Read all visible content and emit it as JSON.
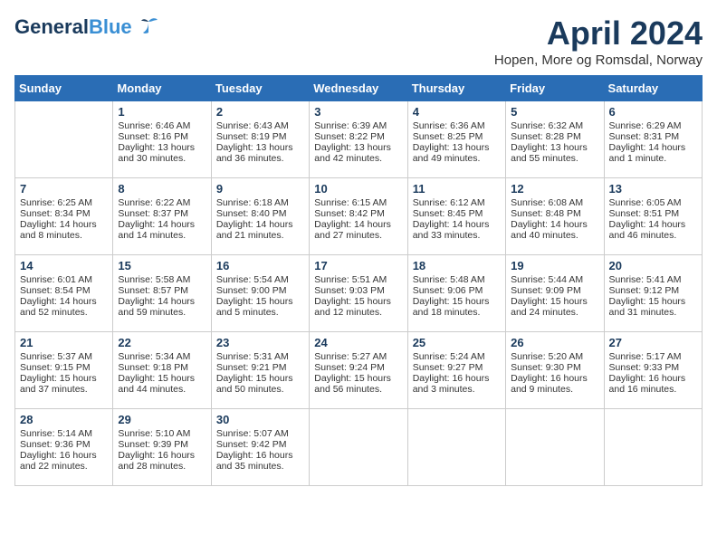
{
  "header": {
    "logo_general": "General",
    "logo_blue": "Blue",
    "month": "April 2024",
    "location": "Hopen, More og Romsdal, Norway"
  },
  "days_of_week": [
    "Sunday",
    "Monday",
    "Tuesday",
    "Wednesday",
    "Thursday",
    "Friday",
    "Saturday"
  ],
  "weeks": [
    [
      {
        "day": "",
        "info": ""
      },
      {
        "day": "1",
        "info": "Sunrise: 6:46 AM\nSunset: 8:16 PM\nDaylight: 13 hours\nand 30 minutes."
      },
      {
        "day": "2",
        "info": "Sunrise: 6:43 AM\nSunset: 8:19 PM\nDaylight: 13 hours\nand 36 minutes."
      },
      {
        "day": "3",
        "info": "Sunrise: 6:39 AM\nSunset: 8:22 PM\nDaylight: 13 hours\nand 42 minutes."
      },
      {
        "day": "4",
        "info": "Sunrise: 6:36 AM\nSunset: 8:25 PM\nDaylight: 13 hours\nand 49 minutes."
      },
      {
        "day": "5",
        "info": "Sunrise: 6:32 AM\nSunset: 8:28 PM\nDaylight: 13 hours\nand 55 minutes."
      },
      {
        "day": "6",
        "info": "Sunrise: 6:29 AM\nSunset: 8:31 PM\nDaylight: 14 hours\nand 1 minute."
      }
    ],
    [
      {
        "day": "7",
        "info": "Sunrise: 6:25 AM\nSunset: 8:34 PM\nDaylight: 14 hours\nand 8 minutes."
      },
      {
        "day": "8",
        "info": "Sunrise: 6:22 AM\nSunset: 8:37 PM\nDaylight: 14 hours\nand 14 minutes."
      },
      {
        "day": "9",
        "info": "Sunrise: 6:18 AM\nSunset: 8:40 PM\nDaylight: 14 hours\nand 21 minutes."
      },
      {
        "day": "10",
        "info": "Sunrise: 6:15 AM\nSunset: 8:42 PM\nDaylight: 14 hours\nand 27 minutes."
      },
      {
        "day": "11",
        "info": "Sunrise: 6:12 AM\nSunset: 8:45 PM\nDaylight: 14 hours\nand 33 minutes."
      },
      {
        "day": "12",
        "info": "Sunrise: 6:08 AM\nSunset: 8:48 PM\nDaylight: 14 hours\nand 40 minutes."
      },
      {
        "day": "13",
        "info": "Sunrise: 6:05 AM\nSunset: 8:51 PM\nDaylight: 14 hours\nand 46 minutes."
      }
    ],
    [
      {
        "day": "14",
        "info": "Sunrise: 6:01 AM\nSunset: 8:54 PM\nDaylight: 14 hours\nand 52 minutes."
      },
      {
        "day": "15",
        "info": "Sunrise: 5:58 AM\nSunset: 8:57 PM\nDaylight: 14 hours\nand 59 minutes."
      },
      {
        "day": "16",
        "info": "Sunrise: 5:54 AM\nSunset: 9:00 PM\nDaylight: 15 hours\nand 5 minutes."
      },
      {
        "day": "17",
        "info": "Sunrise: 5:51 AM\nSunset: 9:03 PM\nDaylight: 15 hours\nand 12 minutes."
      },
      {
        "day": "18",
        "info": "Sunrise: 5:48 AM\nSunset: 9:06 PM\nDaylight: 15 hours\nand 18 minutes."
      },
      {
        "day": "19",
        "info": "Sunrise: 5:44 AM\nSunset: 9:09 PM\nDaylight: 15 hours\nand 24 minutes."
      },
      {
        "day": "20",
        "info": "Sunrise: 5:41 AM\nSunset: 9:12 PM\nDaylight: 15 hours\nand 31 minutes."
      }
    ],
    [
      {
        "day": "21",
        "info": "Sunrise: 5:37 AM\nSunset: 9:15 PM\nDaylight: 15 hours\nand 37 minutes."
      },
      {
        "day": "22",
        "info": "Sunrise: 5:34 AM\nSunset: 9:18 PM\nDaylight: 15 hours\nand 44 minutes."
      },
      {
        "day": "23",
        "info": "Sunrise: 5:31 AM\nSunset: 9:21 PM\nDaylight: 15 hours\nand 50 minutes."
      },
      {
        "day": "24",
        "info": "Sunrise: 5:27 AM\nSunset: 9:24 PM\nDaylight: 15 hours\nand 56 minutes."
      },
      {
        "day": "25",
        "info": "Sunrise: 5:24 AM\nSunset: 9:27 PM\nDaylight: 16 hours\nand 3 minutes."
      },
      {
        "day": "26",
        "info": "Sunrise: 5:20 AM\nSunset: 9:30 PM\nDaylight: 16 hours\nand 9 minutes."
      },
      {
        "day": "27",
        "info": "Sunrise: 5:17 AM\nSunset: 9:33 PM\nDaylight: 16 hours\nand 16 minutes."
      }
    ],
    [
      {
        "day": "28",
        "info": "Sunrise: 5:14 AM\nSunset: 9:36 PM\nDaylight: 16 hours\nand 22 minutes."
      },
      {
        "day": "29",
        "info": "Sunrise: 5:10 AM\nSunset: 9:39 PM\nDaylight: 16 hours\nand 28 minutes."
      },
      {
        "day": "30",
        "info": "Sunrise: 5:07 AM\nSunset: 9:42 PM\nDaylight: 16 hours\nand 35 minutes."
      },
      {
        "day": "",
        "info": ""
      },
      {
        "day": "",
        "info": ""
      },
      {
        "day": "",
        "info": ""
      },
      {
        "day": "",
        "info": ""
      }
    ]
  ]
}
